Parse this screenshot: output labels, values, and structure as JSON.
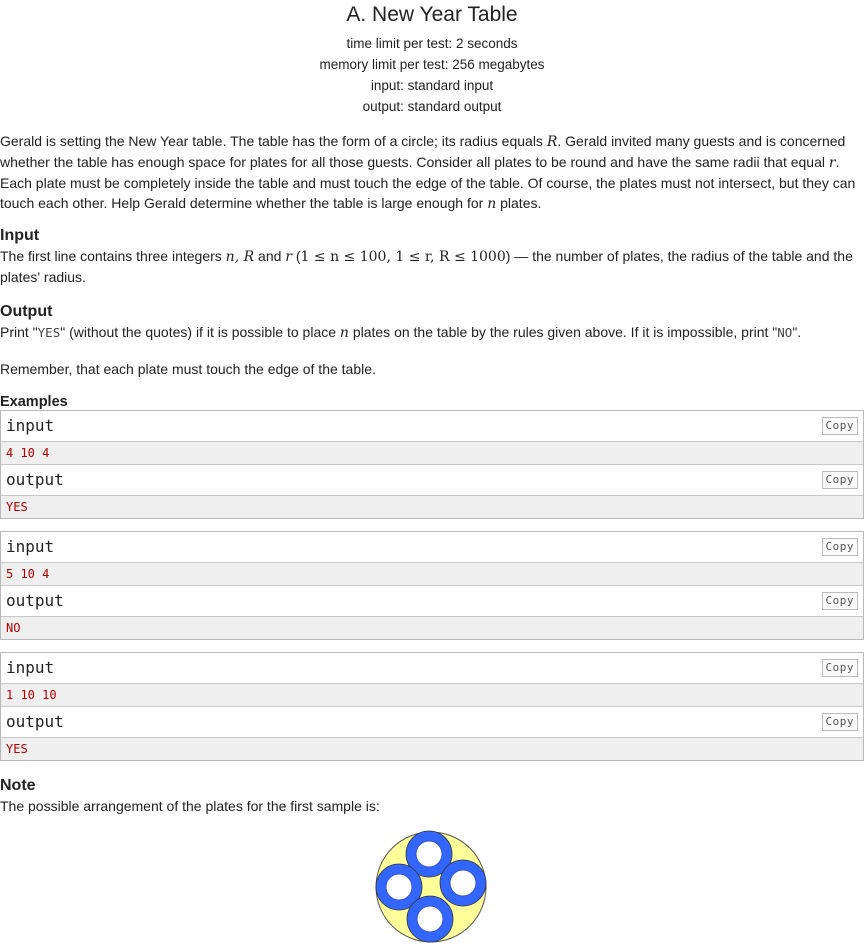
{
  "header": {
    "title": "A. New Year Table",
    "time_limit": "time limit per test: 2 seconds",
    "memory_limit": "memory limit per test: 256 megabytes",
    "input": "input: standard input",
    "output": "output: standard output"
  },
  "statement": {
    "p1_a": "Gerald is setting the New Year table. The table has the form of a circle; its radius equals ",
    "R": "R",
    "p1_b": ". Gerald invited many guests and is concerned",
    "p1_c": "whether the table has enough space for plates for all those guests. Consider all plates to be round and have the same radii that equal ",
    "r": "r",
    "p1_d": ".",
    "p1_e": "Each plate must be completely inside the table and must touch the edge of the table. Of course, the plates must not intersect, but they can",
    "p1_f": "touch each other. Help Gerald determine whether the table is large enough for ",
    "n": "n",
    "p1_g": " plates."
  },
  "input_section": {
    "title": "Input",
    "t1": "The first line contains three integers ",
    "vars1": "n, R",
    "and": " and ",
    "var_r": "r",
    "t2": " (",
    "constraint": "1 ≤ n ≤ 100, 1 ≤ r, R ≤ 1000",
    "t3": ") — the number of plates, the radius of the table and the",
    "t4": "plates' radius."
  },
  "output_section": {
    "title": "Output",
    "t1": "Print \"",
    "yes": "YES",
    "t2": "\" (without the quotes) if it is possible to place ",
    "n": "n",
    "t3": " plates on the table by the rules given above. If it is impossible, print \"",
    "no": "NO",
    "t4": "\".",
    "remember": "Remember, that each plate must touch the edge of the table."
  },
  "examples": {
    "title": "Examples",
    "copy_label": "Copy",
    "input_label": "input",
    "output_label": "output",
    "items": [
      {
        "input": "4 10 4",
        "output": "YES"
      },
      {
        "input": "5 10 4",
        "output": "NO"
      },
      {
        "input": "1 10 10",
        "output": "YES"
      }
    ]
  },
  "note": {
    "title": "Note",
    "text": "The possible arrangement of the plates for the first sample is:"
  },
  "colors": {
    "table_fill": "#ffff99",
    "plate_fill": "#3366ff",
    "data_text": "#b00000"
  }
}
